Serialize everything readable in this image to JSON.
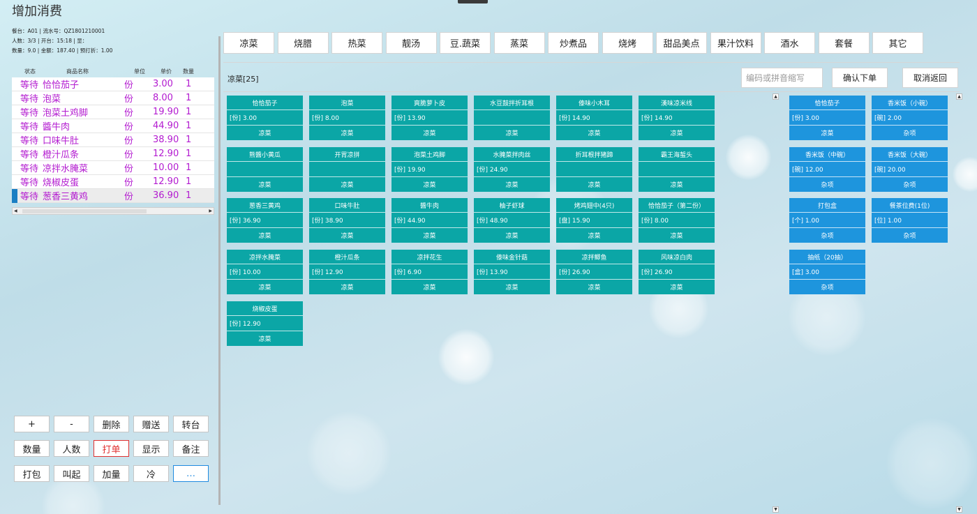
{
  "window": {
    "title": "增加消费"
  },
  "info": {
    "line1": "餐台：A01 | 流水号：QZ1801210001",
    "line2": "人数：3/3 | 开台：15:18 | 显：",
    "line3": "数量：9.0 | 金额：187.40 | 预打折：1.00"
  },
  "order": {
    "headers": [
      "状态",
      "商品名称",
      "单位",
      "单价",
      "数量"
    ],
    "rows": [
      {
        "status": "等待",
        "name": "恰恰茄子",
        "unit": "份",
        "price": "3.00",
        "qty": "1"
      },
      {
        "status": "等待",
        "name": "泡菜",
        "unit": "份",
        "price": "8.00",
        "qty": "1"
      },
      {
        "status": "等待",
        "name": "泡菜土鸡脚",
        "unit": "份",
        "price": "19.90",
        "qty": "1"
      },
      {
        "status": "等待",
        "name": "醬牛肉",
        "unit": "份",
        "price": "44.90",
        "qty": "1"
      },
      {
        "status": "等待",
        "name": "口味牛肚",
        "unit": "份",
        "price": "38.90",
        "qty": "1"
      },
      {
        "status": "等待",
        "name": "橙汁瓜条",
        "unit": "份",
        "price": "12.90",
        "qty": "1"
      },
      {
        "status": "等待",
        "name": "凉拌水腌菜",
        "unit": "份",
        "price": "10.00",
        "qty": "1"
      },
      {
        "status": "等待",
        "name": "烧椒皮蛋",
        "unit": "份",
        "price": "12.90",
        "qty": "1"
      },
      {
        "status": "等待",
        "name": "葱香三黄鸡",
        "unit": "份",
        "price": "36.90",
        "qty": "1",
        "selected": true
      }
    ]
  },
  "actions": [
    [
      {
        "key": "add",
        "label": "+"
      },
      {
        "key": "minus",
        "label": "-"
      },
      {
        "key": "delete",
        "label": "删除"
      },
      {
        "key": "gift",
        "label": "赠送"
      },
      {
        "key": "transfer",
        "label": "转台"
      }
    ],
    [
      {
        "key": "quantity",
        "label": "数量"
      },
      {
        "key": "guests",
        "label": "人数"
      },
      {
        "key": "print",
        "label": "打单",
        "style": "red"
      },
      {
        "key": "display",
        "label": "显示"
      },
      {
        "key": "note",
        "label": "备注"
      }
    ],
    [
      {
        "key": "pack",
        "label": "打包"
      },
      {
        "key": "call",
        "label": "叫起"
      },
      {
        "key": "extra",
        "label": "加量"
      },
      {
        "key": "cold",
        "label": "冷"
      },
      {
        "key": "more",
        "label": "…",
        "style": "blue"
      }
    ]
  ],
  "categories": [
    "凉菜",
    "烧腊",
    "热菜",
    "靓汤",
    "豆.蔬菜",
    "蒸菜",
    "炒煮品",
    "烧烤",
    "甜品美点",
    "果汁饮料",
    "酒水",
    "套餐",
    "其它"
  ],
  "section": {
    "label": "凉菜[25]"
  },
  "search": {
    "placeholder": "编码或拼音缩写"
  },
  "controls": {
    "confirm": "确认下单",
    "cancel": "取消返回"
  },
  "dishes": [
    {
      "name": "恰恰茄子",
      "price": "[份] 3.00",
      "cat": "凉菜"
    },
    {
      "name": "泡菜",
      "price": "[份] 8.00",
      "cat": "凉菜"
    },
    {
      "name": "爽脆萝卜皮",
      "price": "[份] 13.90",
      "cat": "凉菜"
    },
    {
      "name": "水豆鼓拌折耳根",
      "price": "",
      "cat": "凉菜"
    },
    {
      "name": "傣味小木耳",
      "price": "[份] 14.90",
      "cat": "凉菜"
    },
    {
      "name": "漢味凉米线",
      "price": "[份] 14.90",
      "cat": "凉菜"
    },
    {
      "name": "熊醬小黄瓜",
      "price": "",
      "cat": "凉菜"
    },
    {
      "name": "开胃凉拼",
      "price": "",
      "cat": "凉菜"
    },
    {
      "name": "泡菜土鸡脚",
      "price": "[份] 19.90",
      "cat": "凉菜"
    },
    {
      "name": "水腌菜拌肉丝",
      "price": "[份] 24.90",
      "cat": "凉菜"
    },
    {
      "name": "折耳根拌猪蹄",
      "price": "",
      "cat": "凉菜"
    },
    {
      "name": "霸王海蜇头",
      "price": "",
      "cat": "凉菜"
    },
    {
      "name": "葱香三黄鸡",
      "price": "[份] 36.90",
      "cat": "凉菜"
    },
    {
      "name": "口味牛肚",
      "price": "[份] 38.90",
      "cat": "凉菜"
    },
    {
      "name": "醬牛肉",
      "price": "[份] 44.90",
      "cat": "凉菜"
    },
    {
      "name": "柚子虾球",
      "price": "[份] 48.90",
      "cat": "凉菜"
    },
    {
      "name": "烤鸡翅中(4只)",
      "price": "[盘] 15.90",
      "cat": "凉菜"
    },
    {
      "name": "恰恰茄子（第二份）",
      "price": "[份] 8.00",
      "cat": "凉菜"
    },
    {
      "name": "凉拌水腌菜",
      "price": "[份] 10.00",
      "cat": "凉菜"
    },
    {
      "name": "橙汁瓜条",
      "price": "[份] 12.90",
      "cat": "凉菜"
    },
    {
      "name": "凉拌花生",
      "price": "[份] 6.90",
      "cat": "凉菜"
    },
    {
      "name": "傣味金针菇",
      "price": "[份] 13.90",
      "cat": "凉菜"
    },
    {
      "name": "凉拌鲫鱼",
      "price": "[份] 26.90",
      "cat": "凉菜"
    },
    {
      "name": "风味凉白肉",
      "price": "[份] 26.90",
      "cat": "凉菜"
    },
    {
      "name": "烧椒皮蛋",
      "price": "[份] 12.90",
      "cat": "凉菜"
    }
  ],
  "extras": [
    {
      "name": "恰恰茄子",
      "price": "[份] 3.00",
      "cat": "凉菜"
    },
    {
      "name": "香米饭（小碗）",
      "price": "[碗] 2.00",
      "cat": "杂项"
    },
    {
      "name": "香米饭（中碗）",
      "price": "[碗] 12.00",
      "cat": "杂项"
    },
    {
      "name": "香米饭（大碗）",
      "price": "[碗] 20.00",
      "cat": "杂项"
    },
    {
      "name": "打包盒",
      "price": "[个] 1.00",
      "cat": "杂项"
    },
    {
      "name": "餐茶位费(1位)",
      "price": "[位] 1.00",
      "cat": "杂项"
    },
    {
      "name": "抽纸（20抽）",
      "price": "[盒] 3.00",
      "cat": "杂项"
    }
  ]
}
